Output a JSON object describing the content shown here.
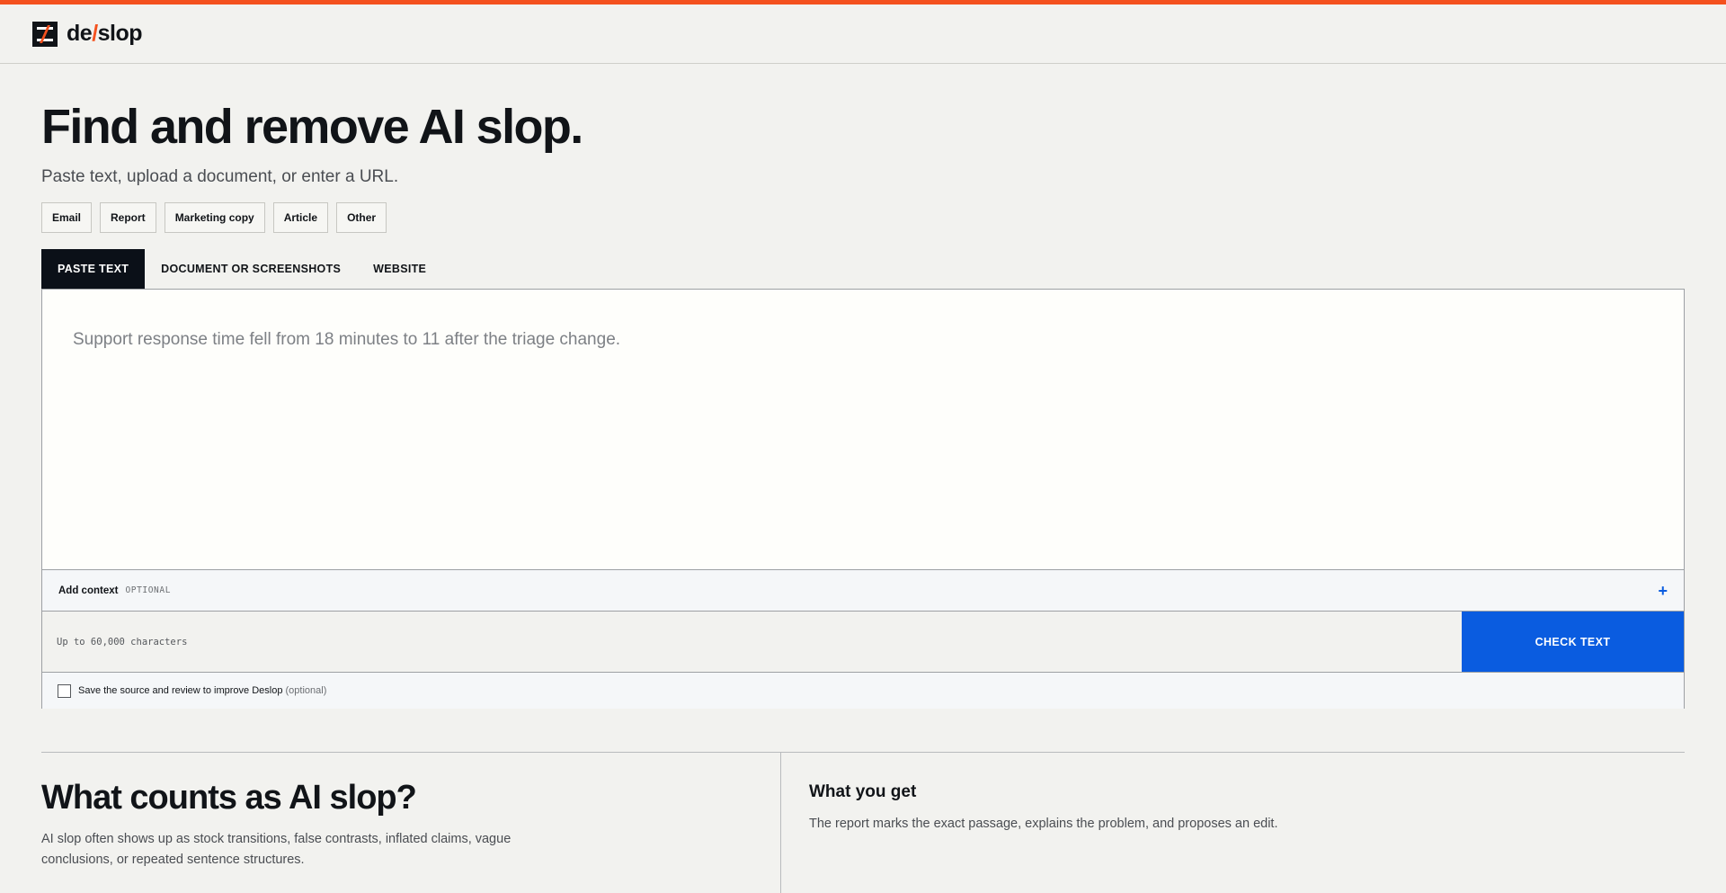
{
  "brand": {
    "name_left": "de",
    "name_slash": "/",
    "name_right": "slop",
    "accent_color": "#f4511e",
    "primary_color": "#0a5ce0"
  },
  "hero": {
    "title": "Find and remove AI slop.",
    "subtitle": "Paste text, upload a document, or enter a URL."
  },
  "chips": [
    "Email",
    "Report",
    "Marketing copy",
    "Article",
    "Other"
  ],
  "tabs": [
    {
      "label": "PASTE TEXT",
      "active": true
    },
    {
      "label": "DOCUMENT OR SCREENSHOTS",
      "active": false
    },
    {
      "label": "WEBSITE",
      "active": false
    }
  ],
  "input": {
    "placeholder": "Support response time fell from 18 minutes to 11 after the triage change."
  },
  "context": {
    "label": "Add context",
    "optional": "OPTIONAL",
    "expand_icon": "plus-icon"
  },
  "actions": {
    "char_limit": "Up to 60,000 characters",
    "check_label": "CHECK TEXT"
  },
  "save": {
    "label": "Save the source and review to improve Deslop",
    "optional": "(optional)",
    "checked": false
  },
  "info": {
    "title": "What counts as AI slop?",
    "body": "AI slop often shows up as stock transitions, false contrasts, inflated claims, vague conclusions, or repeated sentence structures."
  },
  "get": {
    "title": "What you get",
    "body": "The report marks the exact passage, explains the problem, and proposes an edit."
  }
}
